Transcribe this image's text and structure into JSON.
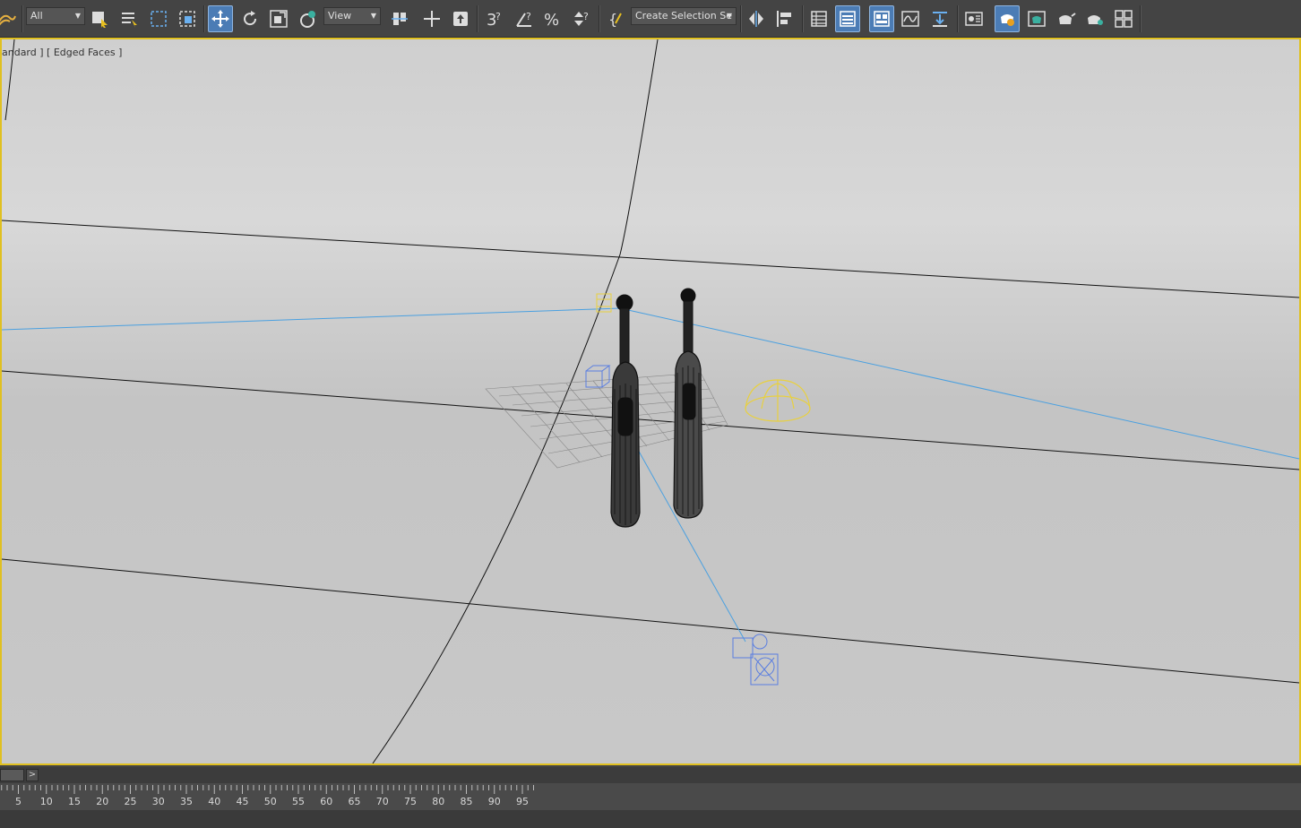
{
  "toolbar": {
    "filter_dropdown": "All",
    "coord_dropdown": "View",
    "selection_set_dropdown": "Create Selection Se",
    "icons": [
      "undo-redo-icon",
      "select-object-icon",
      "select-by-name-icon",
      "rect-selection-icon",
      "window-crossing-icon",
      "move-icon",
      "rotate-icon",
      "scale-icon",
      "placement-icon",
      "pivot-icon",
      "select-manipulate-icon",
      "keyboard-shortcut-icon",
      "snap-3d-icon",
      "angle-snap-icon",
      "percent-snap-icon",
      "spinner-snap-icon",
      "edit-named-sets-icon",
      "mirror-icon",
      "align-icon",
      "scene-explorer-icon",
      "layer-explorer-icon",
      "toggle-ribbon-icon",
      "curve-editor-icon",
      "schematic-view-icon",
      "material-editor-icon",
      "render-setup-icon",
      "rendered-frame-icon",
      "render-production-icon",
      "render-iterative-icon",
      "viewport-layout-icon"
    ]
  },
  "viewport": {
    "label": "andard ] [ Edged Faces ]",
    "objects": [
      "toothbrush-left",
      "toothbrush-right",
      "camera-target",
      "grid-plane",
      "light-dome",
      "camera",
      "box-helper"
    ]
  },
  "timeslider": {
    "next_label": ">"
  },
  "trackbar": {
    "ticks": [
      5,
      10,
      15,
      20,
      25,
      30,
      35,
      40,
      45,
      50,
      55,
      60,
      65,
      70,
      75,
      80,
      85,
      90,
      95
    ]
  },
  "colors": {
    "accent_active": "#4b7cb5",
    "viewport_border": "#e0c020",
    "camera_line": "#4aa0e0",
    "light_yellow": "#e8d040",
    "helper_blue": "#5a7ee0"
  }
}
